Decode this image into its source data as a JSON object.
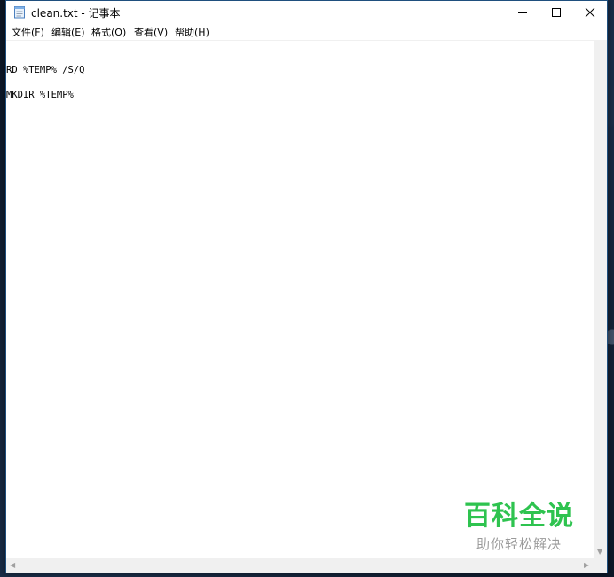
{
  "window": {
    "title": "clean.txt - 记事本",
    "controls": {
      "minimize": "minimize-icon",
      "maximize": "maximize-icon",
      "close": "close-icon"
    }
  },
  "menu": [
    {
      "label": "文件(F)"
    },
    {
      "label": "编辑(E)"
    },
    {
      "label": "格式(O)"
    },
    {
      "label": "查看(V)"
    },
    {
      "label": "帮助(H)"
    }
  ],
  "editor": {
    "lines": [
      "RD %TEMP% /S/Q",
      "MKDIR %TEMP%"
    ]
  },
  "watermark": {
    "main": "百科全说",
    "sub": "助你轻松解决",
    "color": "#2ec34f"
  }
}
